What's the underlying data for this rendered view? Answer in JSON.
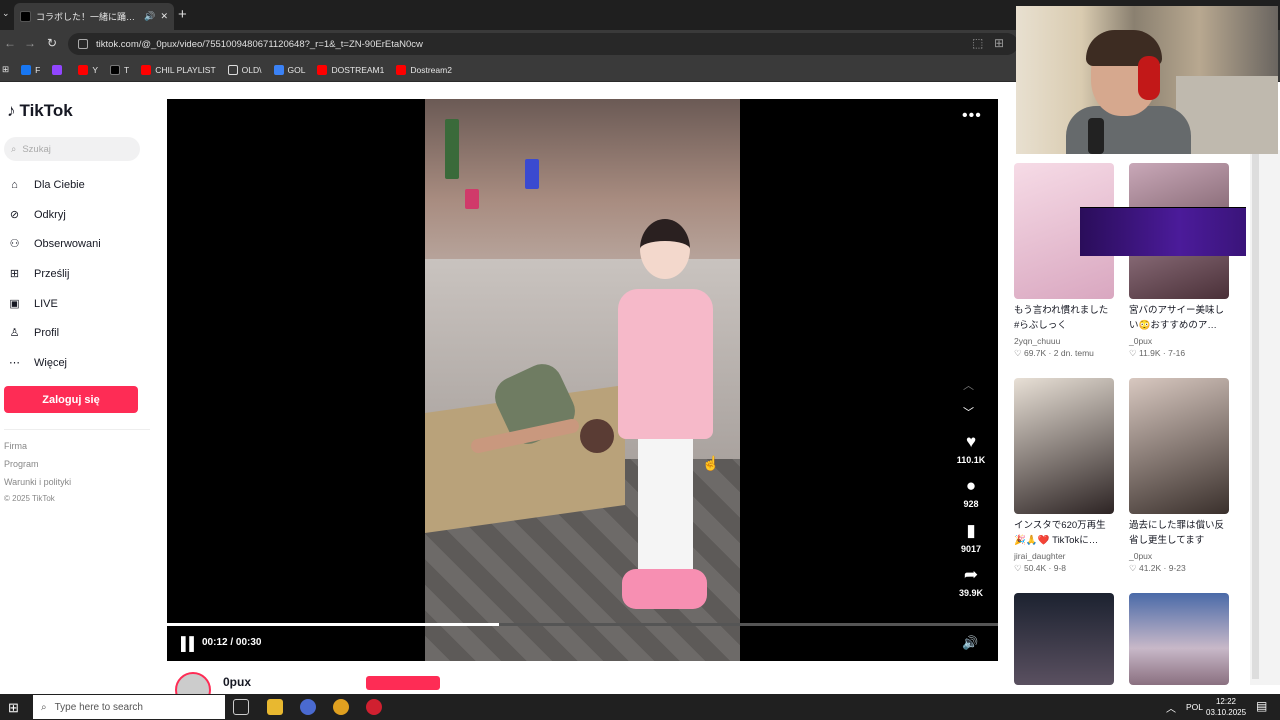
{
  "browser": {
    "tab_title": "コラボした！一緒に踊ってくれた",
    "url": "tiktok.com/@_0pux/video/7551009480671120648?_r=1&_t=ZN-90ErEtaN0cw",
    "bookmarks": [
      {
        "label": "F",
        "color": "#1877f2"
      },
      {
        "label": "",
        "color": "#9146ff"
      },
      {
        "label": "Y",
        "color": "#ff0000"
      },
      {
        "label": "T",
        "color": "#000000"
      },
      {
        "label": "CHIL PLAYLIST",
        "color": "#ff0000"
      },
      {
        "label": "OLD\\",
        "color": "#f2c94c"
      },
      {
        "label": "GOL",
        "color": "#3b82f6"
      },
      {
        "label": "DOSTREAM1",
        "color": "#ff0000"
      },
      {
        "label": "Dostream2",
        "color": "#ff0000"
      }
    ]
  },
  "sidebar": {
    "logo": "TikTok",
    "search_placeholder": "Szukaj",
    "nav": [
      {
        "label": "Dla Ciebie",
        "icon": "home-icon"
      },
      {
        "label": "Odkryj",
        "icon": "compass-icon"
      },
      {
        "label": "Obserwowani",
        "icon": "following-icon"
      },
      {
        "label": "Prześlij",
        "icon": "upload-icon"
      },
      {
        "label": "LIVE",
        "icon": "live-icon"
      },
      {
        "label": "Profil",
        "icon": "profile-icon"
      },
      {
        "label": "Więcej",
        "icon": "more-icon"
      }
    ],
    "login_label": "Zaloguj się",
    "footer": [
      "Firma",
      "Program",
      "Warunki i polityki"
    ],
    "copyright": "© 2025 TikTok"
  },
  "player": {
    "likes": "110.1K",
    "comments": "928",
    "saves": "9017",
    "shares": "39.9K",
    "time": "00:12 / 00:30",
    "progress": 0.4,
    "author": "0pux"
  },
  "recommended": [
    {
      "caption": "もう言われ慣れました #らぶしっく",
      "author": "2yqn_chuuu",
      "stats": "♡ 69.7K · 2 dn. temu",
      "thumb": [
        "#f6dbe6",
        "#d9a7c0"
      ]
    },
    {
      "caption": "宮バのアサイー美味しい😳おすすめのア…",
      "author": "_0pux",
      "stats": "♡ 11.9K · 7-16",
      "thumb": [
        "#c9a8b8",
        "#4a3038"
      ]
    },
    {
      "caption": "インスタで620万再生🎉🙏❤️ TikTokに…",
      "author": "jirai_daughter",
      "stats": "♡ 50.4K · 9-8",
      "thumb": [
        "#e8e0d6",
        "#2d2424"
      ]
    },
    {
      "caption": "過去にした罪は償い反省し更生してます",
      "author": "_0pux",
      "stats": "♡ 41.2K · 9-23",
      "thumb": [
        "#d8c8c0",
        "#3a302c"
      ]
    },
    {
      "caption": "",
      "author": "",
      "stats": "",
      "thumb": [
        "#1c2230",
        "#5a5060"
      ]
    },
    {
      "caption": "",
      "author": "",
      "stats": "",
      "thumb": [
        "#c8b8c8",
        "#8a7080"
      ]
    }
  ],
  "taskbar": {
    "search_placeholder": "Type here to search",
    "lang": "POL",
    "time": "12:22",
    "date": "03.10.2025"
  }
}
